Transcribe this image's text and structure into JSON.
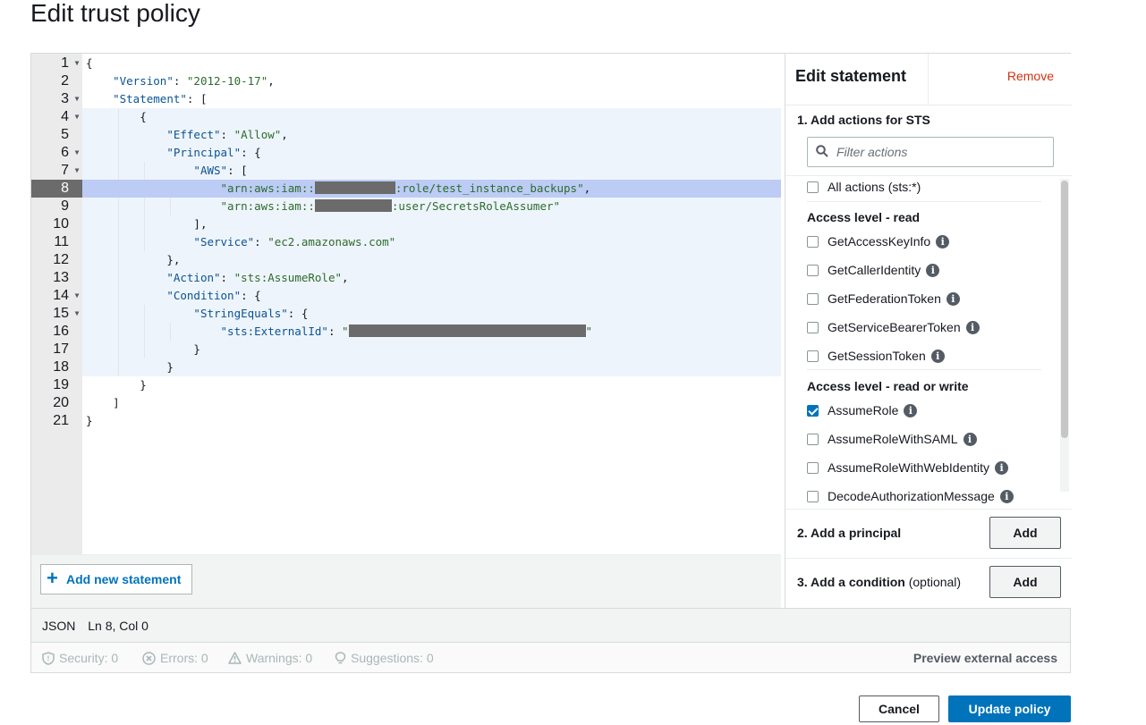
{
  "page": {
    "title": "Edit trust policy"
  },
  "editor": {
    "lines": [
      {
        "n": "1",
        "fold": true
      },
      {
        "n": "2"
      },
      {
        "n": "3",
        "fold": true
      },
      {
        "n": "4",
        "fold": true
      },
      {
        "n": "5"
      },
      {
        "n": "6",
        "fold": true
      },
      {
        "n": "7",
        "fold": true
      },
      {
        "n": "8",
        "active": true
      },
      {
        "n": "9"
      },
      {
        "n": "10"
      },
      {
        "n": "11"
      },
      {
        "n": "12"
      },
      {
        "n": "13"
      },
      {
        "n": "14",
        "fold": true
      },
      {
        "n": "15",
        "fold": true
      },
      {
        "n": "16"
      },
      {
        "n": "17"
      },
      {
        "n": "18"
      },
      {
        "n": "19"
      },
      {
        "n": "20"
      },
      {
        "n": "21"
      }
    ],
    "code": {
      "l1": "{",
      "l2_key": "\"Version\"",
      "l2_val": "\"2012-10-17\"",
      "l3_key": "\"Statement\"",
      "l3_tail": ": [",
      "l4": "{",
      "l5_key": "\"Effect\"",
      "l5_val": "\"Allow\"",
      "l6_key": "\"Principal\"",
      "l6_tail": ": {",
      "l7_key": "\"AWS\"",
      "l7_tail": ": [",
      "l8_pre": "\"arn:aws:iam::",
      "l8_post": ":role/test_instance_backups\"",
      "l9_pre": "\"arn:aws:iam::",
      "l9_post": ":user/SecretsRoleAssumer\"",
      "l10": "],",
      "l11_key": "\"Service\"",
      "l11_val": "\"ec2.amazonaws.com\"",
      "l12": "},",
      "l13_key": "\"Action\"",
      "l13_val": "\"sts:AssumeRole\"",
      "l14_key": "\"Condition\"",
      "l14_tail": ": {",
      "l15_key": "\"StringEquals\"",
      "l15_tail": ": {",
      "l16_key": "\"sts:ExternalId\"",
      "l16_pre": "\"",
      "l16_post": "\"",
      "l17": "}",
      "l18": "}",
      "l19": "}",
      "l20": "]",
      "l21": "}"
    },
    "add_statement_label": "Add new statement"
  },
  "side": {
    "tab_label": "Edit statement",
    "remove_label": "Remove",
    "step1": "1. Add actions for STS",
    "filter_placeholder": "Filter actions",
    "all_actions": "All actions (sts:*)",
    "level_read": "Access level - read",
    "read_actions": [
      "GetAccessKeyInfo",
      "GetCallerIdentity",
      "GetFederationToken",
      "GetServiceBearerToken",
      "GetSessionToken"
    ],
    "level_rw": "Access level - read or write",
    "rw_actions": [
      "AssumeRole",
      "AssumeRoleWithSAML",
      "AssumeRoleWithWebIdentity",
      "DecodeAuthorizationMessage"
    ],
    "checked_action": "AssumeRole",
    "step2": "2. Add a principal",
    "step3": "3. Add a condition",
    "step3_opt": "(optional)",
    "add_label": "Add"
  },
  "status": {
    "mode": "JSON",
    "cursor": "Ln 8, Col 0"
  },
  "validation": {
    "security": "Security: 0",
    "errors": "Errors: 0",
    "warnings": "Warnings: 0",
    "suggestions": "Suggestions: 0",
    "preview": "Preview external access"
  },
  "footer": {
    "cancel": "Cancel",
    "update": "Update policy"
  },
  "colors": {
    "primary": "#0073bb",
    "remove": "#d13212",
    "json_key": "#0b5394",
    "json_string": "#2e6b2e",
    "active_line": "#bcccf5"
  }
}
